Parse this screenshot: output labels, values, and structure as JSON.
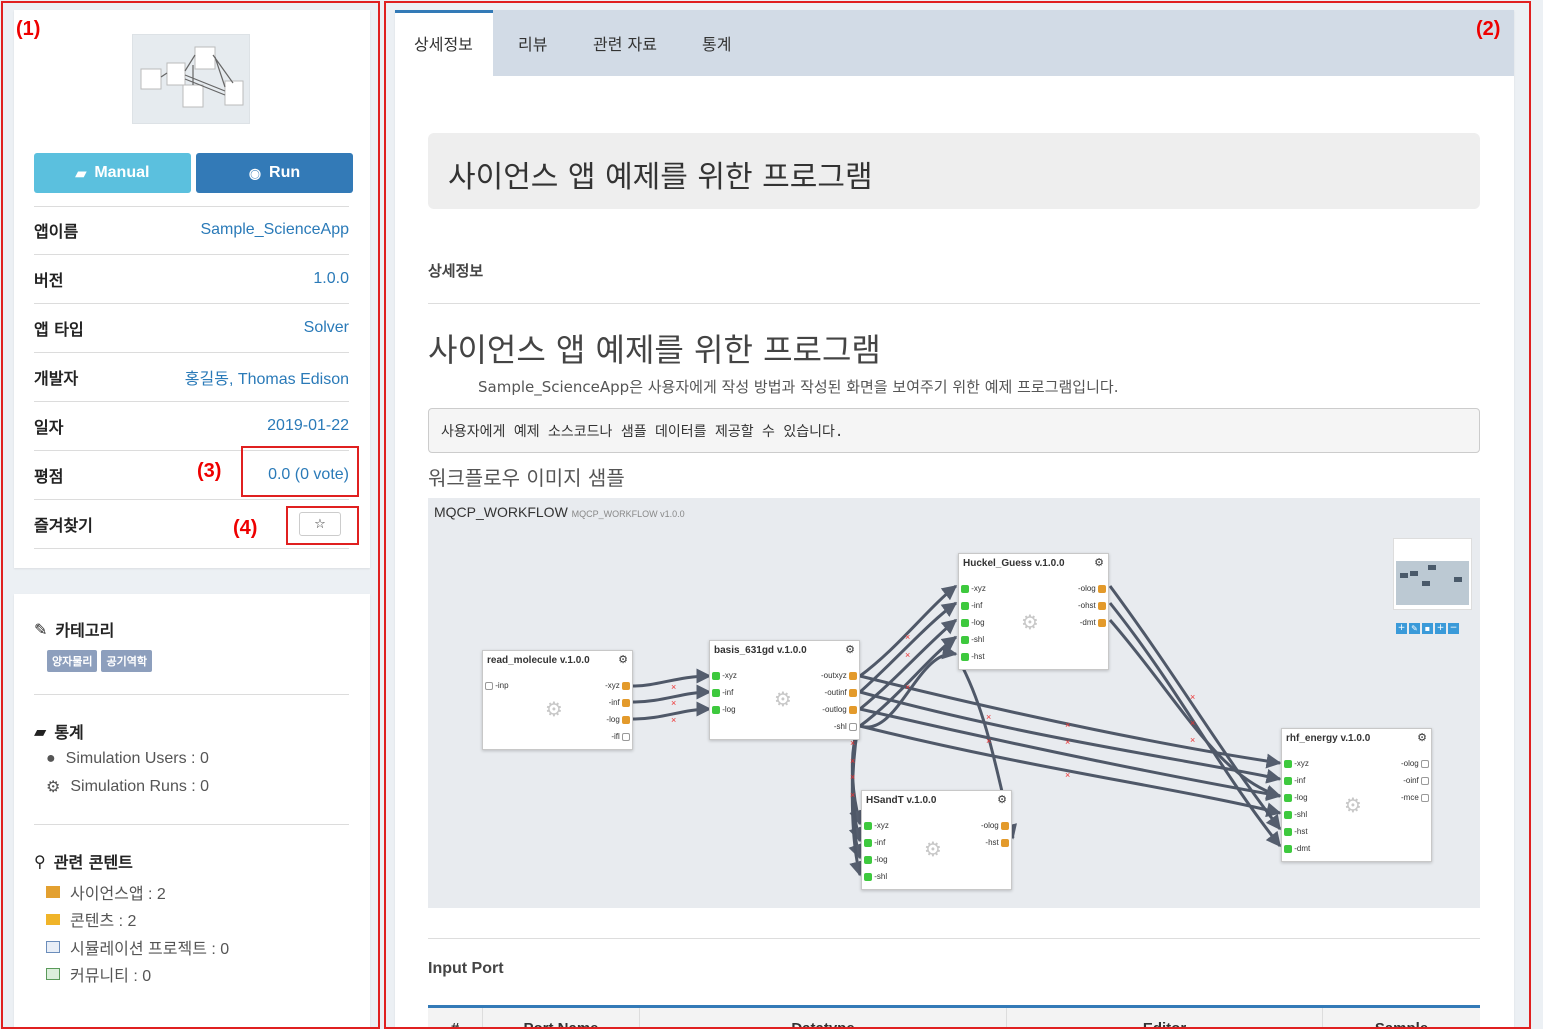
{
  "annotations": {
    "a1": "(1)",
    "a2": "(2)",
    "a3": "(3)",
    "a4": "(4)"
  },
  "left": {
    "manual_label": "Manual",
    "run_label": "Run",
    "rows": [
      {
        "key": "앱이름",
        "value": "Sample_ScienceApp"
      },
      {
        "key": "버전",
        "value": "1.0.0"
      },
      {
        "key": "앱 타입",
        "value": "Solver"
      },
      {
        "key": "개발자",
        "value": "홍길동, Thomas Edison"
      },
      {
        "key": "일자",
        "value": "2019-01-22"
      },
      {
        "key": "평점",
        "value": "0.0 (0 vote)"
      },
      {
        "key": "즐겨찾기",
        "value": "☆"
      }
    ],
    "category": {
      "title": "카테고리",
      "tags": [
        "양자물리",
        "공기역학"
      ]
    },
    "stats": {
      "title": "통계",
      "users": "Simulation Users : 0",
      "runs": "Simulation Runs : 0"
    },
    "related": {
      "title": "관련 콘텐트",
      "items": [
        "사이언스앱 : 2",
        "콘텐츠 : 2",
        "시뮬레이션 프로젝트 : 0",
        "커뮤니티 : 0"
      ]
    }
  },
  "tabs": [
    "상세정보",
    "리뷰",
    "관련 자료",
    "통계"
  ],
  "main": {
    "banner": "사이언스 앱 예제를 위한 프로그램",
    "section": "상세정보",
    "heading": "사이언스 앱 예제를 위한 프로그램",
    "desc": "Sample_ScienceApp은 사용자에게 작성 방법과 작성된 화면을 보여주기 위한 예제 프로그램입니다.",
    "code": "사용자에게 예제 소스코드나 샘플 데이터를 제공할 수 있습니다.",
    "wf_title": "워크플로우 이미지 샘플",
    "wf_name": "MQCP_WORKFLOW",
    "wf_sub": "MQCP_WORKFLOW v1.0.0",
    "input_port": "Input Port",
    "table_headers": [
      "#",
      "Port Name",
      "Datatype",
      "Editor",
      "Sample"
    ]
  },
  "nodes": {
    "n1": {
      "title": "read_molecule v.1.0.0",
      "in": [
        "-inp"
      ],
      "out": [
        "-xyz",
        "-inf",
        "-log",
        "-ifl"
      ]
    },
    "n2": {
      "title": "basis_631gd v.1.0.0",
      "in": [
        "-xyz",
        "-inf",
        "-log"
      ],
      "out": [
        "-outxyz",
        "-outinf",
        "-outlog",
        "-shl"
      ]
    },
    "n3": {
      "title": "Huckel_Guess v.1.0.0",
      "in": [
        "-xyz",
        "-inf",
        "-log",
        "-shl",
        "-hst"
      ],
      "out": [
        "-olog",
        "-ohst",
        "-dmt"
      ]
    },
    "n4": {
      "title": "HSandT v.1.0.0",
      "in": [
        "-xyz",
        "-inf",
        "-log",
        "-shl"
      ],
      "out": [
        "-olog",
        "-hst"
      ]
    },
    "n5": {
      "title": "rhf_energy v.1.0.0",
      "in": [
        "-xyz",
        "-inf",
        "-log",
        "-shl",
        "-hst",
        "-dmt"
      ],
      "out": [
        "-olog",
        "-oinf",
        "-mce"
      ]
    }
  }
}
